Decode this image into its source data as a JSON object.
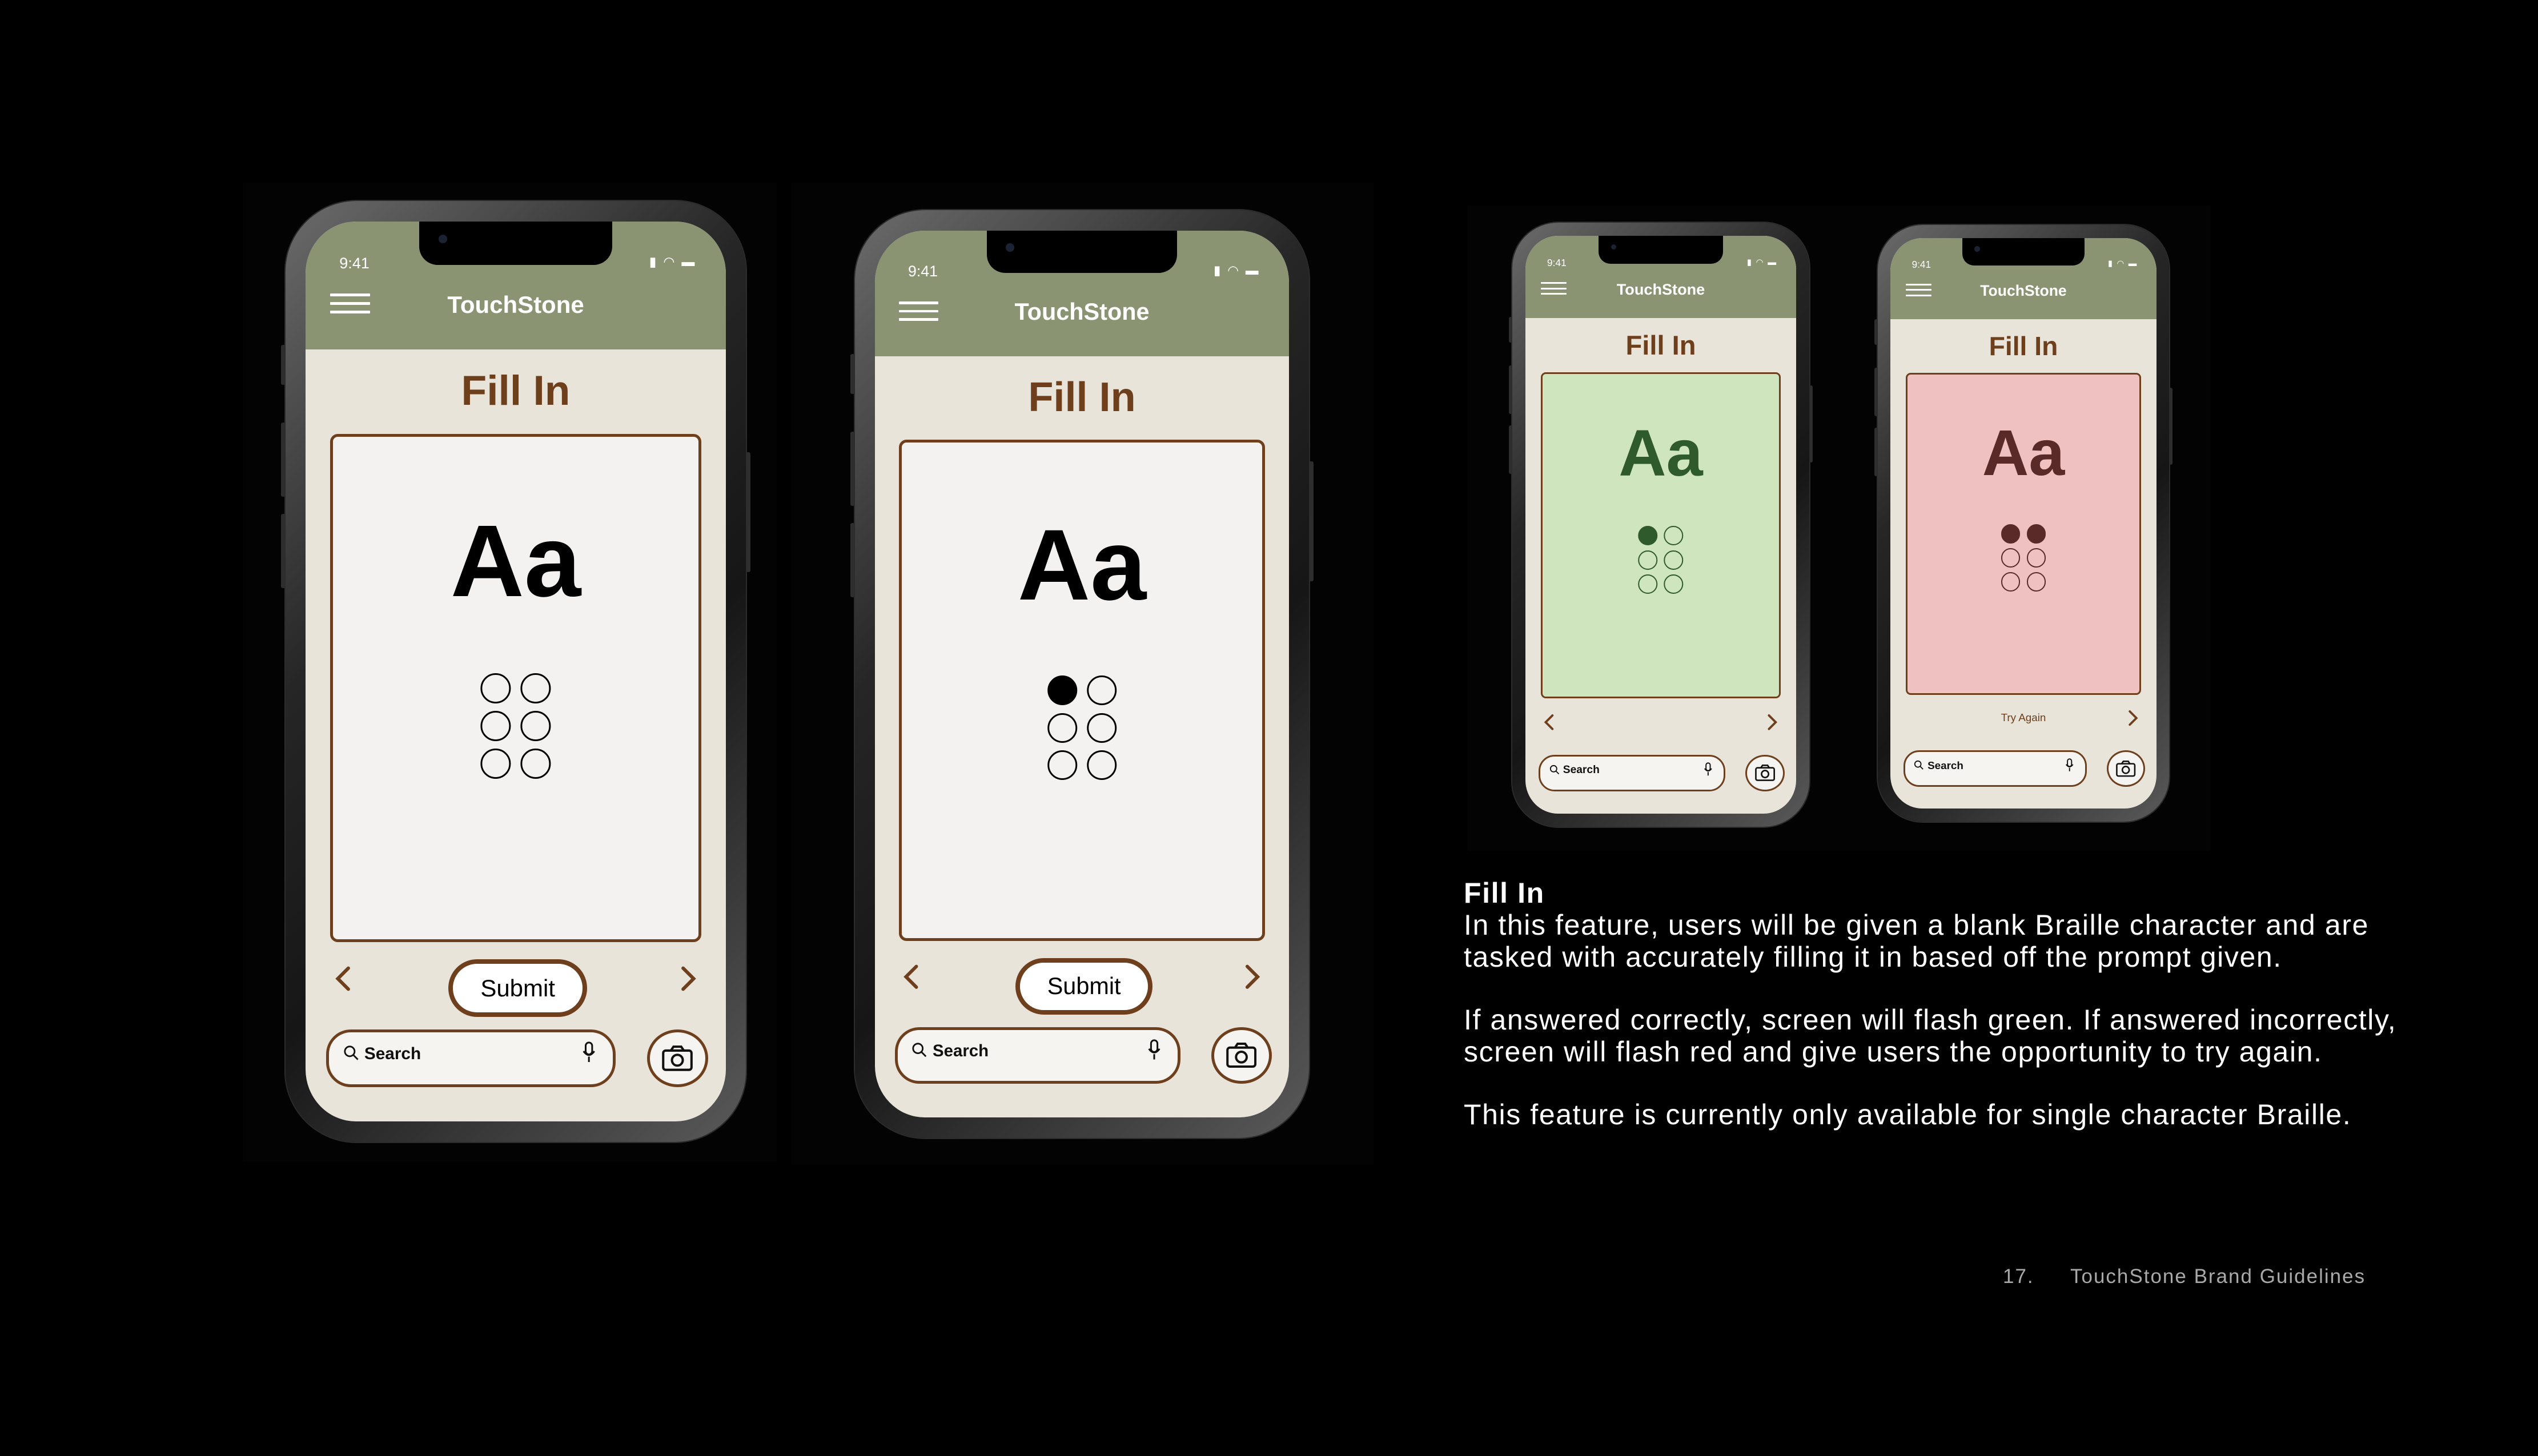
{
  "app": {
    "time": "9:41",
    "title": "TouchStone",
    "screen_title": "Fill In",
    "sample_glyph": "Aa",
    "submit_label": "Submit",
    "try_again_label": "Try Again",
    "search_label": "Search"
  },
  "icons": [
    "menu-icon",
    "chevron-left-icon",
    "chevron-right-icon",
    "search-icon",
    "mic-icon",
    "camera-icon",
    "signal-icon",
    "wifi-icon",
    "battery-icon"
  ],
  "colors": {
    "app_bar": "#8a9473",
    "brown_accent": "#6e3f1c",
    "screen_bg": "#e8e4da",
    "correct_green": "#cfe5bd",
    "incorrect_red": "#efc2c1"
  },
  "phones": [
    {
      "state": "blank",
      "dots": [
        0,
        0,
        0,
        0,
        0,
        0
      ],
      "bottom_action": "submit"
    },
    {
      "state": "dot 1 filled",
      "dots": [
        1,
        0,
        0,
        0,
        0,
        0
      ],
      "bottom_action": "submit"
    },
    {
      "state": "correct",
      "dots": [
        1,
        0,
        0,
        0,
        0,
        0
      ],
      "bottom_action": "none"
    },
    {
      "state": "incorrect",
      "dots": [
        1,
        1,
        0,
        0,
        0,
        0
      ],
      "bottom_action": "try_again"
    }
  ],
  "description": {
    "title": "Fill In",
    "paragraph_1": "In this feature, users will be given a blank Braille character and are tasked with accurately filling it in based off the prompt given.",
    "paragraph_2": "If answered correctly, screen will flash green. If answered incorrectly, screen will flash red and give users the opportunity to try again.",
    "paragraph_3": "This feature is currently only available for single character Braille."
  },
  "footer": {
    "page_number": "17.",
    "document_title": "TouchStone Brand Guidelines"
  }
}
